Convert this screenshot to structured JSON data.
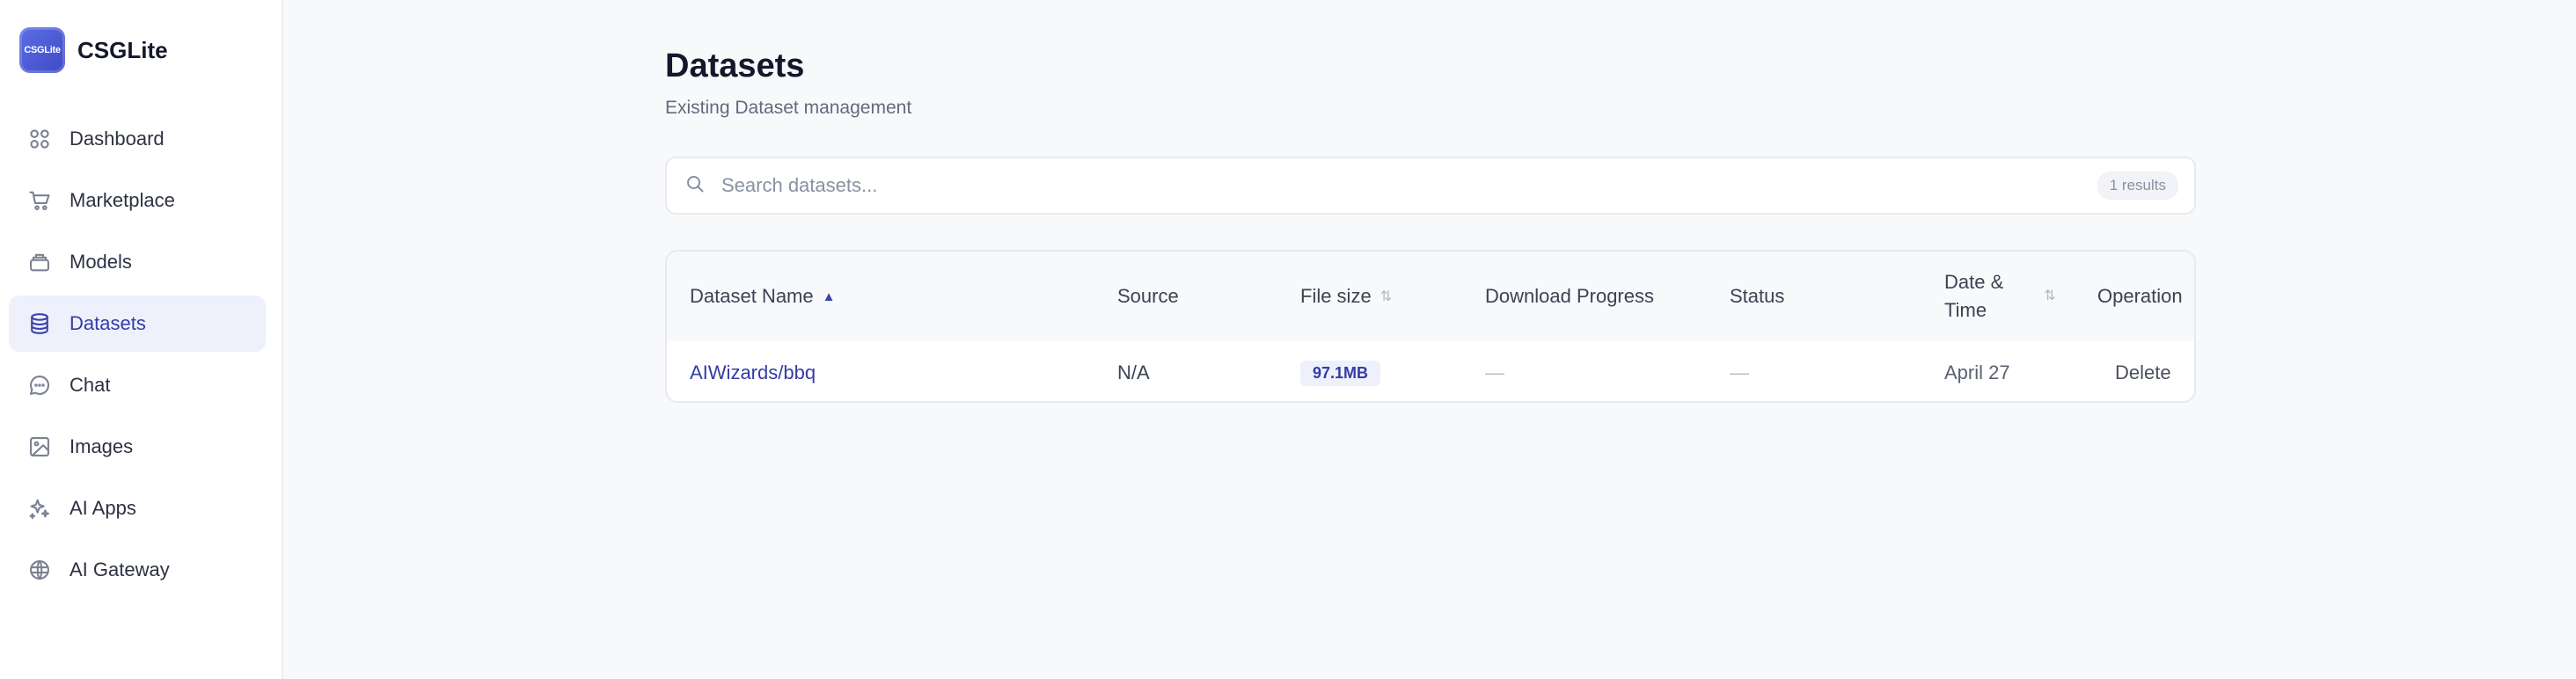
{
  "app": {
    "name": "CSGLite",
    "logo_text": "CSGLite"
  },
  "sidebar": {
    "items": [
      {
        "label": "Dashboard",
        "icon": "dashboard-icon",
        "active": false
      },
      {
        "label": "Marketplace",
        "icon": "cart-icon",
        "active": false
      },
      {
        "label": "Models",
        "icon": "layers-icon",
        "active": false
      },
      {
        "label": "Datasets",
        "icon": "database-icon",
        "active": true
      },
      {
        "label": "Chat",
        "icon": "chat-bubble-icon",
        "active": false
      },
      {
        "label": "Images",
        "icon": "image-icon",
        "active": false
      },
      {
        "label": "AI Apps",
        "icon": "sparkles-icon",
        "active": false
      },
      {
        "label": "AI Gateway",
        "icon": "gateway-icon",
        "active": false
      }
    ]
  },
  "page": {
    "title": "Datasets",
    "subtitle": "Existing Dataset management"
  },
  "search": {
    "placeholder": "Search datasets...",
    "value": "",
    "results_label": "1 results"
  },
  "table": {
    "columns": {
      "name": "Dataset Name",
      "source": "Source",
      "file_size": "File size",
      "download_progress": "Download Progress",
      "status": "Status",
      "date_line1": "Date &",
      "date_line2": "Time",
      "operation": "Operation"
    },
    "sort_arrow_active": "▲",
    "sort_arrow_idle": "⇅",
    "rows": [
      {
        "name": "AIWizards/bbq",
        "source": "N/A",
        "file_size": "97.1MB",
        "download_progress": "—",
        "status": "—",
        "date": "April 27",
        "operation": "Delete"
      }
    ]
  },
  "colors": {
    "accent": "#343ca5",
    "active_nav_bg": "#eef0fc",
    "page_bg": "#f8f9fb"
  }
}
